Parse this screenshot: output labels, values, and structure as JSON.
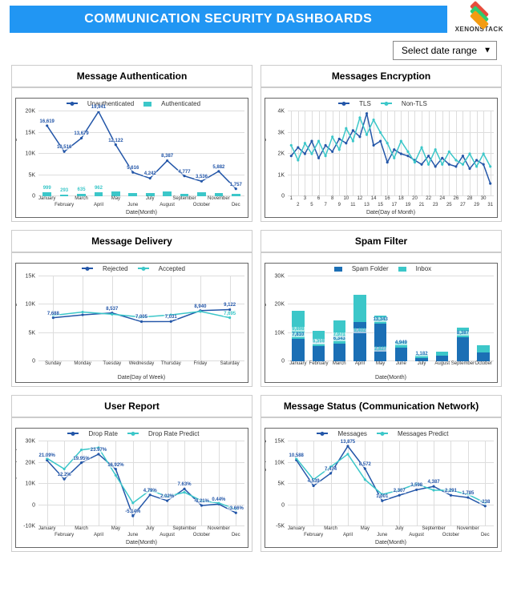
{
  "header": {
    "title": "COMMUNICATION SECURITY DASHBOARDS",
    "brand": "XENONSTACK"
  },
  "toolbar": {
    "date_range_label": "Select date range"
  },
  "colors": {
    "series_dark": "#2356a8",
    "series_light": "#3cc7c9",
    "bar_dark": "#1b6fb5",
    "bar_light": "#3cc7c9"
  },
  "panels": [
    {
      "id": "auth",
      "title": "Message Authentication"
    },
    {
      "id": "enc",
      "title": "Messages Encryption"
    },
    {
      "id": "del",
      "title": "Message Delivery"
    },
    {
      "id": "spam",
      "title": "Spam Filter"
    },
    {
      "id": "user",
      "title": "User Report"
    },
    {
      "id": "stat",
      "title": "Message Status (Communication Network)"
    }
  ],
  "chart_data": [
    {
      "id": "auth",
      "type": "bar+line",
      "title": "",
      "xlabel": "Date(Month)",
      "ylabel": "Messages",
      "categories": [
        "January",
        "February",
        "March",
        "April",
        "May",
        "June",
        "July",
        "August",
        "September",
        "October",
        "November",
        "Dec"
      ],
      "ylim": [
        0,
        20000
      ],
      "yticks": [
        0,
        5000,
        10000,
        15000,
        20000
      ],
      "ytick_labels": [
        "0",
        "5K",
        "10K",
        "15K",
        "20K"
      ],
      "series": [
        {
          "name": "Unauthenticated",
          "kind": "line",
          "color": "#2356a8",
          "values": [
            16619,
            10516,
            13679,
            19941,
            12122,
            5616,
            4242,
            8387,
            4777,
            3536,
            5882,
            1757
          ],
          "labels": [
            "16,619",
            "10,516",
            "13,679",
            "19,941",
            "12,122",
            "5,616",
            "4,242",
            "8,387",
            "4,777",
            "3,536",
            "5,882",
            "1,757"
          ]
        },
        {
          "name": "Authenticated",
          "kind": "bar",
          "color": "#3cc7c9",
          "values": [
            999,
            293,
            635,
            962,
            1200,
            800,
            700,
            1100,
            600,
            900,
            800,
            500
          ],
          "labels": [
            "999",
            "293",
            "635",
            "962",
            "",
            "",
            "",
            "",
            "",
            "",
            "",
            ""
          ]
        }
      ]
    },
    {
      "id": "enc",
      "type": "line",
      "xlabel": "Date(Day of Month)",
      "ylabel": "Messages",
      "categories": [
        "1",
        "2",
        "3",
        "5",
        "6",
        "7",
        "8",
        "9",
        "10",
        "11",
        "12",
        "13",
        "14",
        "15",
        "16",
        "17",
        "18",
        "19",
        "20",
        "21",
        "22",
        "23",
        "24",
        "25",
        "26",
        "27",
        "28",
        "29",
        "30",
        "31"
      ],
      "ylim": [
        0,
        4000
      ],
      "yticks": [
        0,
        1000,
        2000,
        3000,
        4000
      ],
      "ytick_labels": [
        "0",
        "1K",
        "2K",
        "3K",
        "4K"
      ],
      "series": [
        {
          "name": "TLS",
          "kind": "line",
          "color": "#2356a8",
          "values": [
            1900,
            2300,
            2000,
            2600,
            1800,
            2400,
            2100,
            2700,
            2500,
            3100,
            2800,
            3900,
            2400,
            2600,
            1600,
            2200,
            2000,
            1900,
            1700,
            1500,
            1900,
            1400,
            1800,
            1500,
            1400,
            1900,
            1300,
            1700,
            1500,
            600
          ]
        },
        {
          "name": "Non-TLS",
          "kind": "line",
          "color": "#3cc7c9",
          "values": [
            2400,
            1700,
            2500,
            2000,
            2600,
            1900,
            2800,
            2200,
            3200,
            2600,
            3700,
            2900,
            3600,
            3000,
            2500,
            1800,
            2600,
            2100,
            1600,
            2300,
            1500,
            2200,
            1500,
            2100,
            1700,
            1500,
            2000,
            1400,
            2000,
            1400
          ]
        }
      ]
    },
    {
      "id": "del",
      "type": "line",
      "xlabel": "Date(Day of Week)",
      "ylabel": "Messages",
      "categories": [
        "Sunday",
        "Monday",
        "Tuesday",
        "Wednesday",
        "Thursday",
        "Friday",
        "Saturday"
      ],
      "ylim": [
        0,
        15000
      ],
      "yticks": [
        0,
        5000,
        10000,
        15000
      ],
      "ytick_labels": [
        "0",
        "5K",
        "10K",
        "15K"
      ],
      "series": [
        {
          "name": "Rejected",
          "kind": "line",
          "color": "#2356a8",
          "values": [
            7688,
            8200,
            8537,
            7005,
            7031,
            8940,
            9122
          ],
          "labels": [
            "7,688",
            "",
            "8,537",
            "7,005",
            "7,031",
            "8,940",
            "9,122"
          ]
        },
        {
          "name": "Accepted",
          "kind": "line",
          "color": "#3cc7c9",
          "values": [
            8100,
            8700,
            8300,
            7800,
            8200,
            8800,
            7695
          ],
          "labels": [
            "",
            "",
            "",
            "",
            "",
            "",
            "7,695"
          ]
        }
      ]
    },
    {
      "id": "spam",
      "type": "stacked-bar",
      "xlabel": "Date(Month)",
      "ylabel": "Messages",
      "categories": [
        "January",
        "February",
        "March",
        "April",
        "May",
        "June",
        "July",
        "August",
        "September",
        "October"
      ],
      "ylim": [
        0,
        30000
      ],
      "yticks": [
        0,
        10000,
        20000,
        30000
      ],
      "ytick_labels": [
        "0",
        "10K",
        "20K",
        "30K"
      ],
      "series": [
        {
          "name": "Spam Folder",
          "kind": "bar",
          "color": "#1b6fb5",
          "values": [
            7810,
            5251,
            6343,
            14000,
            13343,
            4949,
            1182,
            2000,
            8387,
            3000
          ],
          "labels": [
            "7,810",
            "5,251",
            "6,343",
            "",
            "13,343",
            "4,949",
            "1,182",
            "",
            "8,387",
            ""
          ]
        },
        {
          "name": "Inbox",
          "kind": "bar",
          "color": "#3cc7c9",
          "values": [
            9898,
            5558,
            7971,
            9402,
            2827,
            2000,
            1000,
            1500,
            3500,
            2600
          ],
          "labels": [
            "9,898",
            "5,558",
            "7,971",
            "9,402",
            "2,827",
            "",
            "",
            "",
            "",
            ""
          ]
        }
      ]
    },
    {
      "id": "user",
      "type": "line",
      "xlabel": "Date(Month)",
      "ylabel": "Drop Rate| Drop Rate ...",
      "categories": [
        "January",
        "February",
        "March",
        "April",
        "May",
        "June",
        "July",
        "August",
        "September",
        "October",
        "November",
        "Dec"
      ],
      "ylim": [
        -10000,
        30000
      ],
      "yticks": [
        -10000,
        0,
        10000,
        20000,
        30000
      ],
      "ytick_labels": [
        "-10K",
        "0",
        "10K",
        "20K",
        "30K"
      ],
      "series": [
        {
          "name": "Drop Rate",
          "kind": "line",
          "color": "#2356a8",
          "values": [
            21090,
            12200,
            19950,
            23970,
            16920,
            -5140,
            4790,
            2020,
            7630,
            -210,
            440,
            -3660
          ],
          "labels": [
            "21.09%",
            "12.2%",
            "19.95%",
            "23.97%",
            "16.92%",
            "-5.14%",
            "4.79%",
            "2.02%",
            "7.63%",
            "-0.21%",
            "0.44%",
            "-3.66%"
          ]
        },
        {
          "name": "Drop Rate Predict",
          "kind": "line",
          "color": "#3cc7c9",
          "values": [
            22000,
            17000,
            26000,
            27000,
            14000,
            1000,
            7000,
            4000,
            6000,
            2000,
            1000,
            -2000
          ]
        }
      ]
    },
    {
      "id": "stat",
      "type": "line",
      "xlabel": "Date(Month)",
      "ylabel": "Messages| Messages Predict",
      "categories": [
        "January",
        "February",
        "March",
        "April",
        "May",
        "June",
        "July",
        "August",
        "September",
        "October",
        "November",
        "Dec"
      ],
      "ylim": [
        -5000,
        15000
      ],
      "yticks": [
        -5000,
        0,
        5000,
        10000,
        15000
      ],
      "ytick_labels": [
        "-5K",
        "0",
        "5K",
        "10K",
        "15K"
      ],
      "series": [
        {
          "name": "Messages",
          "kind": "line",
          "color": "#2356a8",
          "values": [
            10588,
            4539,
            7474,
            13875,
            8572,
            1001,
            2307,
            3598,
            4387,
            2291,
            1785,
            -238
          ],
          "labels": [
            "10,588",
            "4,539",
            "7,474",
            "13,875",
            "8,572",
            "1,001",
            "2,307",
            "3,598",
            "4,387",
            "2,291",
            "1,785",
            "-238"
          ]
        },
        {
          "name": "Messages Predict",
          "kind": "line",
          "color": "#3cc7c9",
          "values": [
            11000,
            6000,
            9000,
            12000,
            6000,
            2500,
            3500,
            5000,
            3500,
            3500,
            2500,
            500
          ]
        }
      ]
    }
  ]
}
